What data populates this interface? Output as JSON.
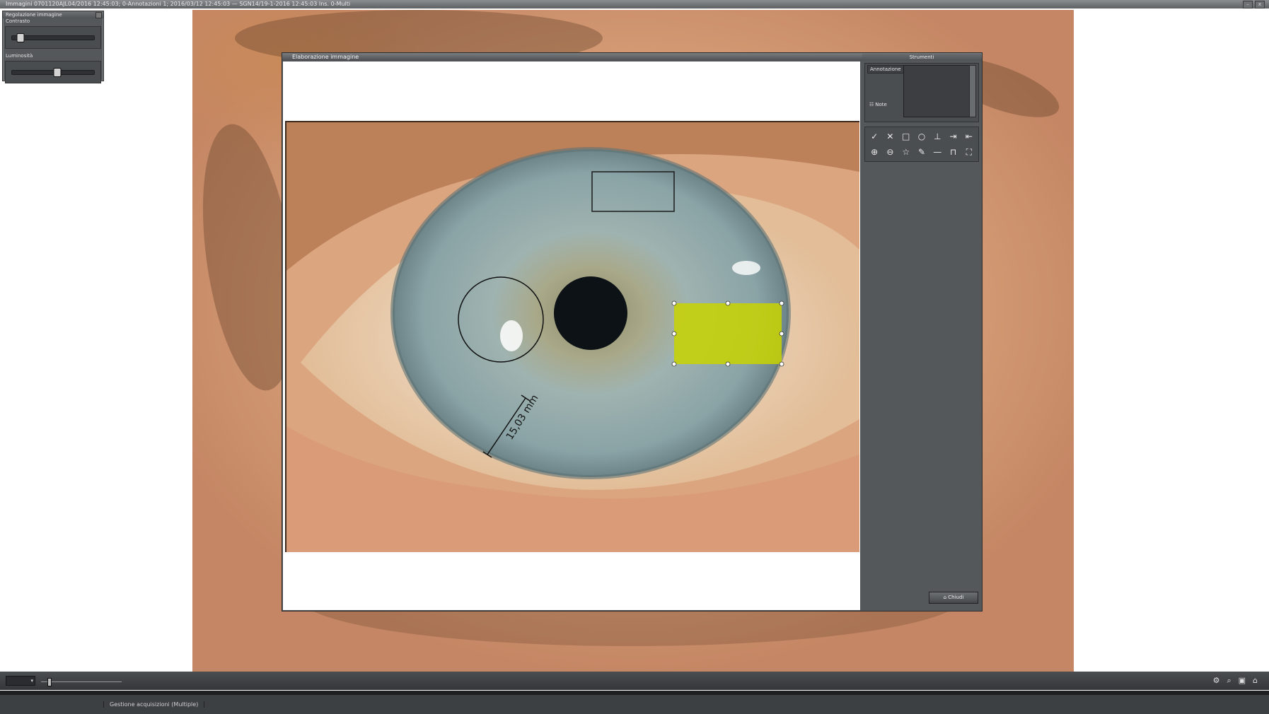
{
  "window": {
    "title": "Immagini 0701120AJL04/2016 12:45:03; 0-Annotazioni 1; 2016/03/12 12:45:03 — SGN14/19-1-2016 12:45:03 Ins. 0-Multi",
    "minimize_label": "–",
    "close_label": "x"
  },
  "adjust_panel": {
    "title": "Regolazione immagine",
    "contrast_label": "Contrasto",
    "contrast_level": 0.1,
    "brightness_label": "Luminosità",
    "brightness_level": 0.55
  },
  "dialog": {
    "title": "Elaborazione immagine",
    "measurement_label": "15,03 mm"
  },
  "tools": {
    "title": "Strumenti",
    "annotation_label": "Annotazione",
    "notes_label": "Note",
    "row1": [
      {
        "name": "check-icon",
        "glyph": "✓"
      },
      {
        "name": "delete-icon",
        "glyph": "✕"
      },
      {
        "name": "rectangle-tool-icon",
        "glyph": "□"
      },
      {
        "name": "circle-tool-icon",
        "glyph": "○"
      },
      {
        "name": "ruler-tool-icon",
        "glyph": "⊥"
      },
      {
        "name": "arrow-right-icon",
        "glyph": "⇥"
      },
      {
        "name": "arrow-left-icon",
        "glyph": "⇤"
      }
    ],
    "row2": [
      {
        "name": "zoom-in-icon",
        "glyph": "⊕"
      },
      {
        "name": "zoom-out-icon",
        "glyph": "⊖"
      },
      {
        "name": "star-icon",
        "glyph": "☆"
      },
      {
        "name": "pen-icon",
        "glyph": "✎"
      },
      {
        "name": "line-tool-icon",
        "glyph": "—"
      },
      {
        "name": "bracket-tool-icon",
        "glyph": "⊓"
      },
      {
        "name": "fit-screen-icon",
        "glyph": "⛶"
      }
    ],
    "close_label": "Chiudi"
  },
  "bottom_bar": {
    "zoom_value": "▾",
    "zoom_level": 0.08,
    "icons": [
      "settings-icon",
      "search-icon",
      "export-icon",
      "home-icon"
    ]
  },
  "status": {
    "text": "Gestione acquisizioni (Multiple)"
  },
  "colors": {
    "panel": "#55585b",
    "highlight": "#c8d400"
  }
}
